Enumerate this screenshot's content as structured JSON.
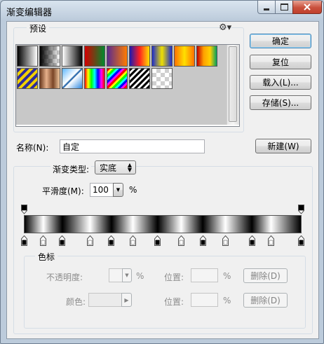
{
  "window": {
    "title": "渐变编辑器"
  },
  "titlebar": {
    "min_icon": "minimize-icon",
    "max_icon": "maximize-icon",
    "close_icon": "close-icon"
  },
  "presets": {
    "label": "预设",
    "menu_icon": "gear-icon",
    "swatches": [
      "linear-gradient(90deg,#000,#fff)",
      "linear-gradient(90deg,#000,rgba(0,0,0,0))",
      "linear-gradient(90deg,#fff,#000)",
      "linear-gradient(90deg,#d40000,#008a2e)",
      "linear-gradient(90deg,#5b2a8f,#ff7b00)",
      "linear-gradient(90deg,#1a1ab0,#ff2020,#ffe000)",
      "linear-gradient(90deg,#1b2bd0,#f0e000,#1b2bd0)",
      "linear-gradient(90deg,#ff7000,#ffe000,#ff7000)",
      "linear-gradient(90deg,#c40000,#ffa000,#ffd000,#00a060)",
      "repeating-linear-gradient(135deg,#2d2d9c 0 4px,#f0d000 4px 8px)",
      "linear-gradient(90deg,#6b3a1f,#e6b08a,#7a4526,#f0c8a0)",
      "linear-gradient(135deg,#5cb6ff,#ffffff 45%,#004c9c 50%,#ffffff 55%,#2f88e0)",
      "linear-gradient(90deg,#ff0000,#ffff00,#00ff00,#00ffff,#0000ff,#ff00ff,#ff0000)",
      "repeating-linear-gradient(135deg,#ff0000 0 3px,#ffff00 3px 6px,#00ff00 6px 9px,#00ffff 9px 12px,#0000ff 12px 15px,#ff00ff 15px 18px)",
      "repeating-linear-gradient(135deg,#000 0 3px,#fff 3px 6px)",
      "transparent"
    ]
  },
  "buttons": {
    "ok": "确定",
    "reset": "复位",
    "load": "载入(L)...",
    "save": "存储(S)...",
    "new": "新建(W)"
  },
  "name": {
    "label": "名称(N):",
    "value": "自定"
  },
  "gradient": {
    "type_label": "渐变类型:",
    "type_value": "实底",
    "smooth_label": "平滑度(M):",
    "smooth_value": "100",
    "smooth_unit": "%",
    "opacity_stops": [
      0,
      1
    ],
    "color_stops": [
      {
        "p": 0.0,
        "c": "#000000"
      },
      {
        "p": 0.068,
        "c": "#ffffff"
      },
      {
        "p": 0.137,
        "c": "#000000"
      },
      {
        "p": 0.237,
        "c": "#ffffff"
      },
      {
        "p": 0.315,
        "c": "#000000"
      },
      {
        "p": 0.392,
        "c": "#ffffff"
      },
      {
        "p": 0.482,
        "c": "#000000"
      },
      {
        "p": 0.567,
        "c": "#ffffff"
      },
      {
        "p": 0.645,
        "c": "#000000"
      },
      {
        "p": 0.727,
        "c": "#ffffff"
      },
      {
        "p": 0.823,
        "c": "#000000"
      },
      {
        "p": 0.892,
        "c": "#ffffff"
      },
      {
        "p": 1.0,
        "c": "#000000"
      }
    ]
  },
  "stops_panel": {
    "label": "色标",
    "opacity_label": "不透明度:",
    "percent": "%",
    "position_label": "位置:",
    "delete": "删除(D)",
    "color_label": "颜色:"
  }
}
